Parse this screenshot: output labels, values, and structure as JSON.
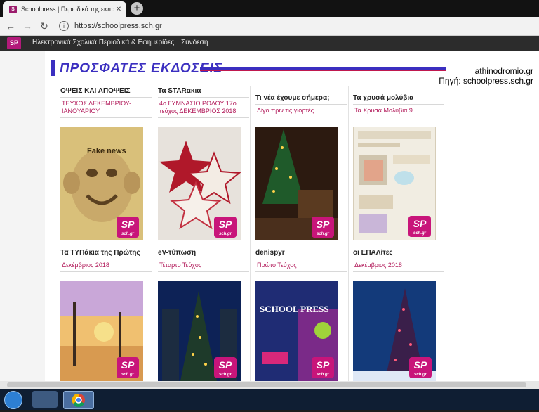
{
  "browser": {
    "tab_title": "Schoolpress | Περιοδικά της εκπαίδε",
    "new_tab": "+",
    "url": "https://schoolpress.sch.gr"
  },
  "site_nav": {
    "logo": "SP",
    "links": [
      "Ηλεκτρονικά Σχολικά Περιοδικά & Εφημερίδες",
      "Σύνδεση"
    ]
  },
  "main": {
    "heading": "ΠΡΟΣΦΑΤΕΣ ΕΚΔΟΣΕΙΣ",
    "source_line1": "athinodromio.gr",
    "source_line2": "Πηγή: schoolpress.sch.gr",
    "badge": "SP",
    "badge_small": "sch.gr",
    "cards": [
      {
        "name": "ΟΨΕΙΣ ΚΑΙ ΑΠΟΨΕΙΣ",
        "issue": "ΤΕΥΧΟΣ ΔΕΚΕΜΒΡΙΟΥ-ΙΑΝΟΥΑΡΙΟΥ"
      },
      {
        "name": "Τα STARακια",
        "issue": "4ο ΓΥΜΝΑΣΙΟ ΡΟΔΟΥ 17ο τεύχος ΔΕΚΕΜΒΡΙΟΣ 2018"
      },
      {
        "name": "Τι νέα έχουμε σήμερα;",
        "issue": "Λίγο πριν τις γιορτές"
      },
      {
        "name": "Τα χρυσά μολύβια",
        "issue": "Τα Χρυσά Μολύβια 9"
      },
      {
        "name": "Τα ΤΥΠάκια της Πρώτης",
        "issue": "Δεκέμβριος 2018"
      },
      {
        "name": "eV-τύπωση",
        "issue": "Τέταρτο Τεύχος"
      },
      {
        "name": "denispyr",
        "issue": "Πρώτο Τεύχος"
      },
      {
        "name": "οι ΕΠΑΛίτες",
        "issue": "Δεκέμβριος 2018"
      }
    ],
    "cover_texts": {
      "fake_news": "Fake news",
      "school_press": "SCHOOL PRESS"
    }
  }
}
